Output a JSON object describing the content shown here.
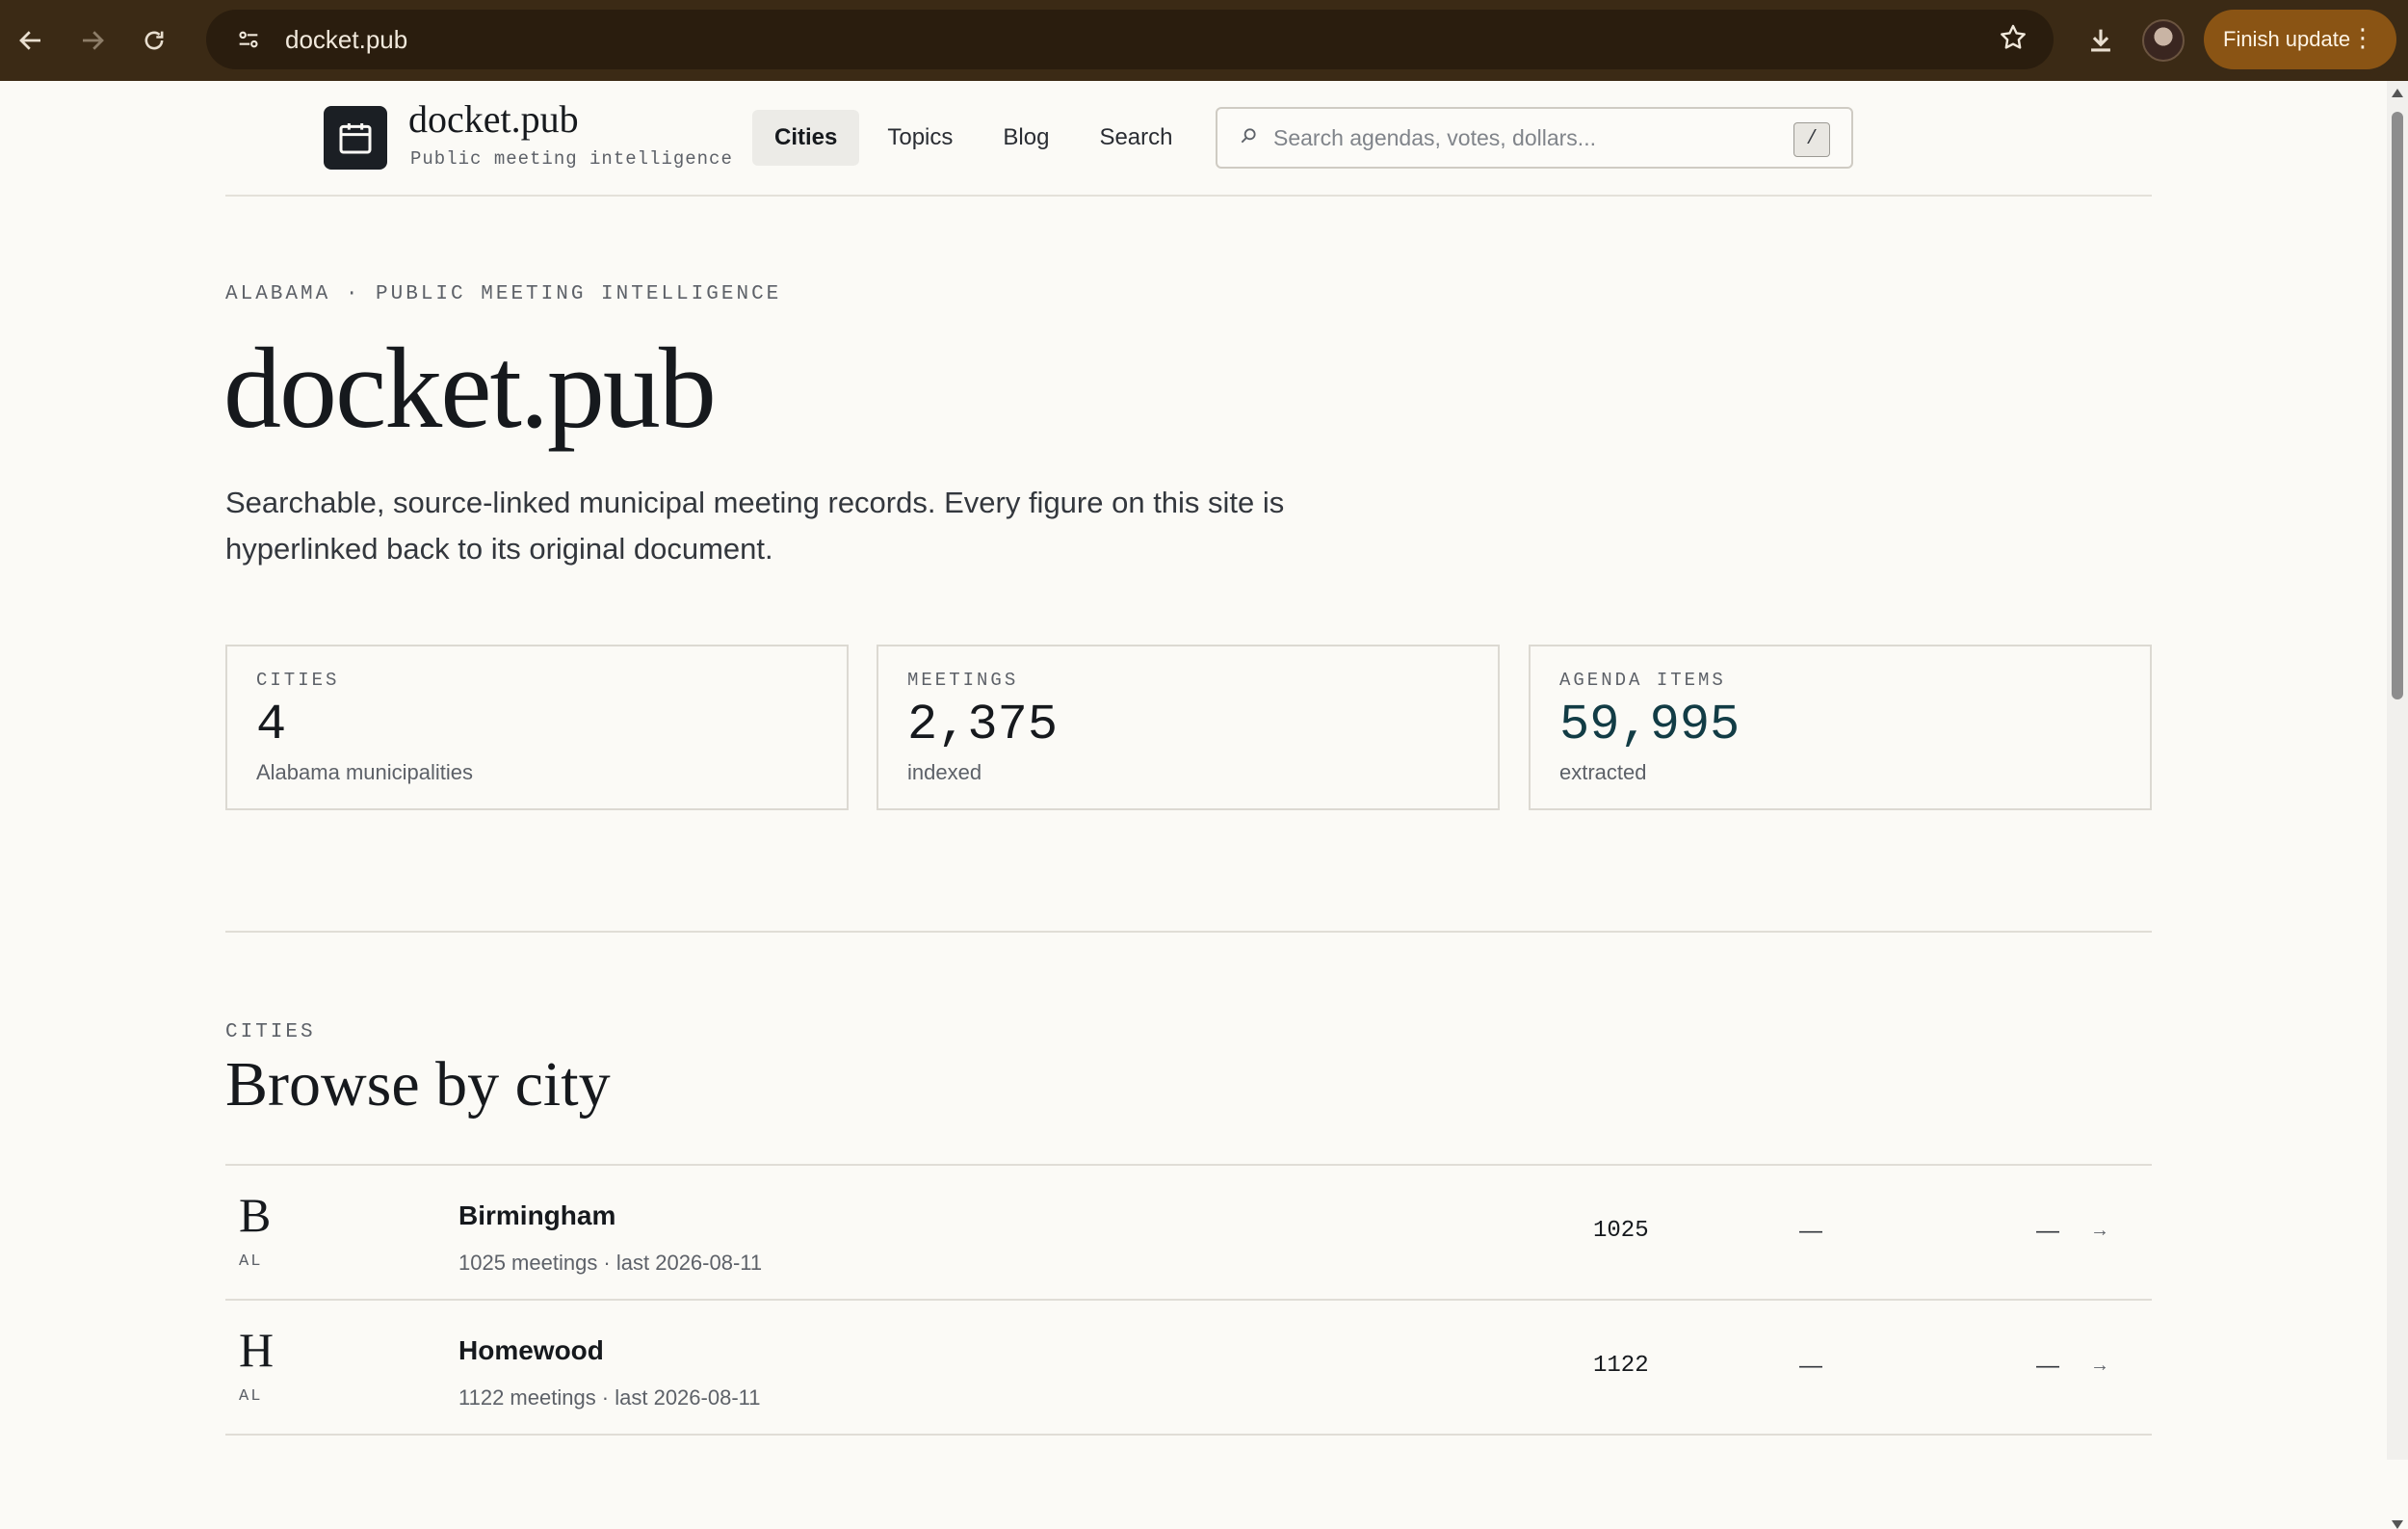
{
  "browser": {
    "url": "docket.pub",
    "finish_update_label": "Finish update"
  },
  "header": {
    "brand_title": "docket.pub",
    "brand_subtitle": "Public meeting intelligence",
    "nav": [
      "Cities",
      "Topics",
      "Blog",
      "Search"
    ],
    "active_nav": "Cities",
    "search_placeholder": "Search agendas, votes, dollars...",
    "search_shortcut": "/"
  },
  "hero": {
    "eyebrow": "ALABAMA · PUBLIC MEETING INTELLIGENCE",
    "title": "docket.pub",
    "description": "Searchable, source-linked municipal meeting records. Every figure on this site is hyperlinked back to its original document."
  },
  "stats": [
    {
      "label": "CITIES",
      "value": "4",
      "note": "Alabama municipalities"
    },
    {
      "label": "MEETINGS",
      "value": "2,375",
      "note": "indexed"
    },
    {
      "label": "AGENDA ITEMS",
      "value": "59,995",
      "note": "extracted"
    }
  ],
  "cities_section": {
    "eyebrow": "CITIES",
    "title": "Browse by city",
    "rows": [
      {
        "initial": "B",
        "state": "AL",
        "name": "Birmingham",
        "meta": "1025 meetings · last 2026-08-11",
        "count": "1025",
        "col2": "—",
        "col3": "—",
        "arrow": "→"
      },
      {
        "initial": "H",
        "state": "AL",
        "name": "Homewood",
        "meta": "1122 meetings · last 2026-08-11",
        "count": "1122",
        "col2": "—",
        "col3": "—",
        "arrow": "→"
      }
    ]
  },
  "colors": {
    "chrome": "#3b2a15",
    "accent_value": "#123c45",
    "page_bg": "#fbfaf6"
  }
}
